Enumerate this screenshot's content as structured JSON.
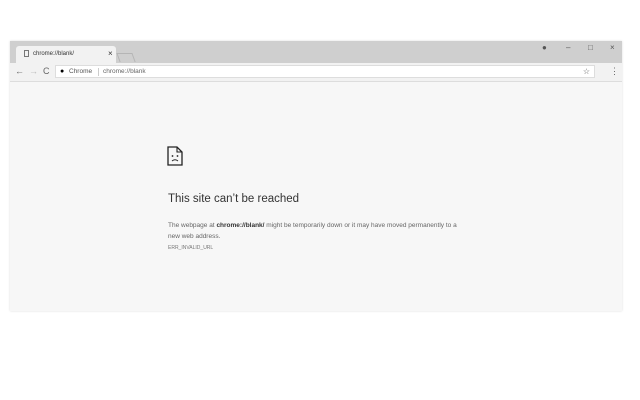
{
  "tab": {
    "title": "chrome://blank/",
    "close": "×"
  },
  "window_controls": {
    "profile": "●",
    "minimize": "–",
    "maximize": "□",
    "close": "×"
  },
  "toolbar": {
    "back": "←",
    "forward": "→",
    "reload": "C",
    "security_chip": "Chrome",
    "url": "chrome://blank",
    "star": "☆",
    "menu": "⋮"
  },
  "error": {
    "title": "This site can’t be reached",
    "msg_pre": "The webpage at ",
    "msg_url": "chrome://blank/",
    "msg_post": " might be temporarily down or it may have moved permanently to a new web address.",
    "code": "ERR_INVALID_URL"
  }
}
